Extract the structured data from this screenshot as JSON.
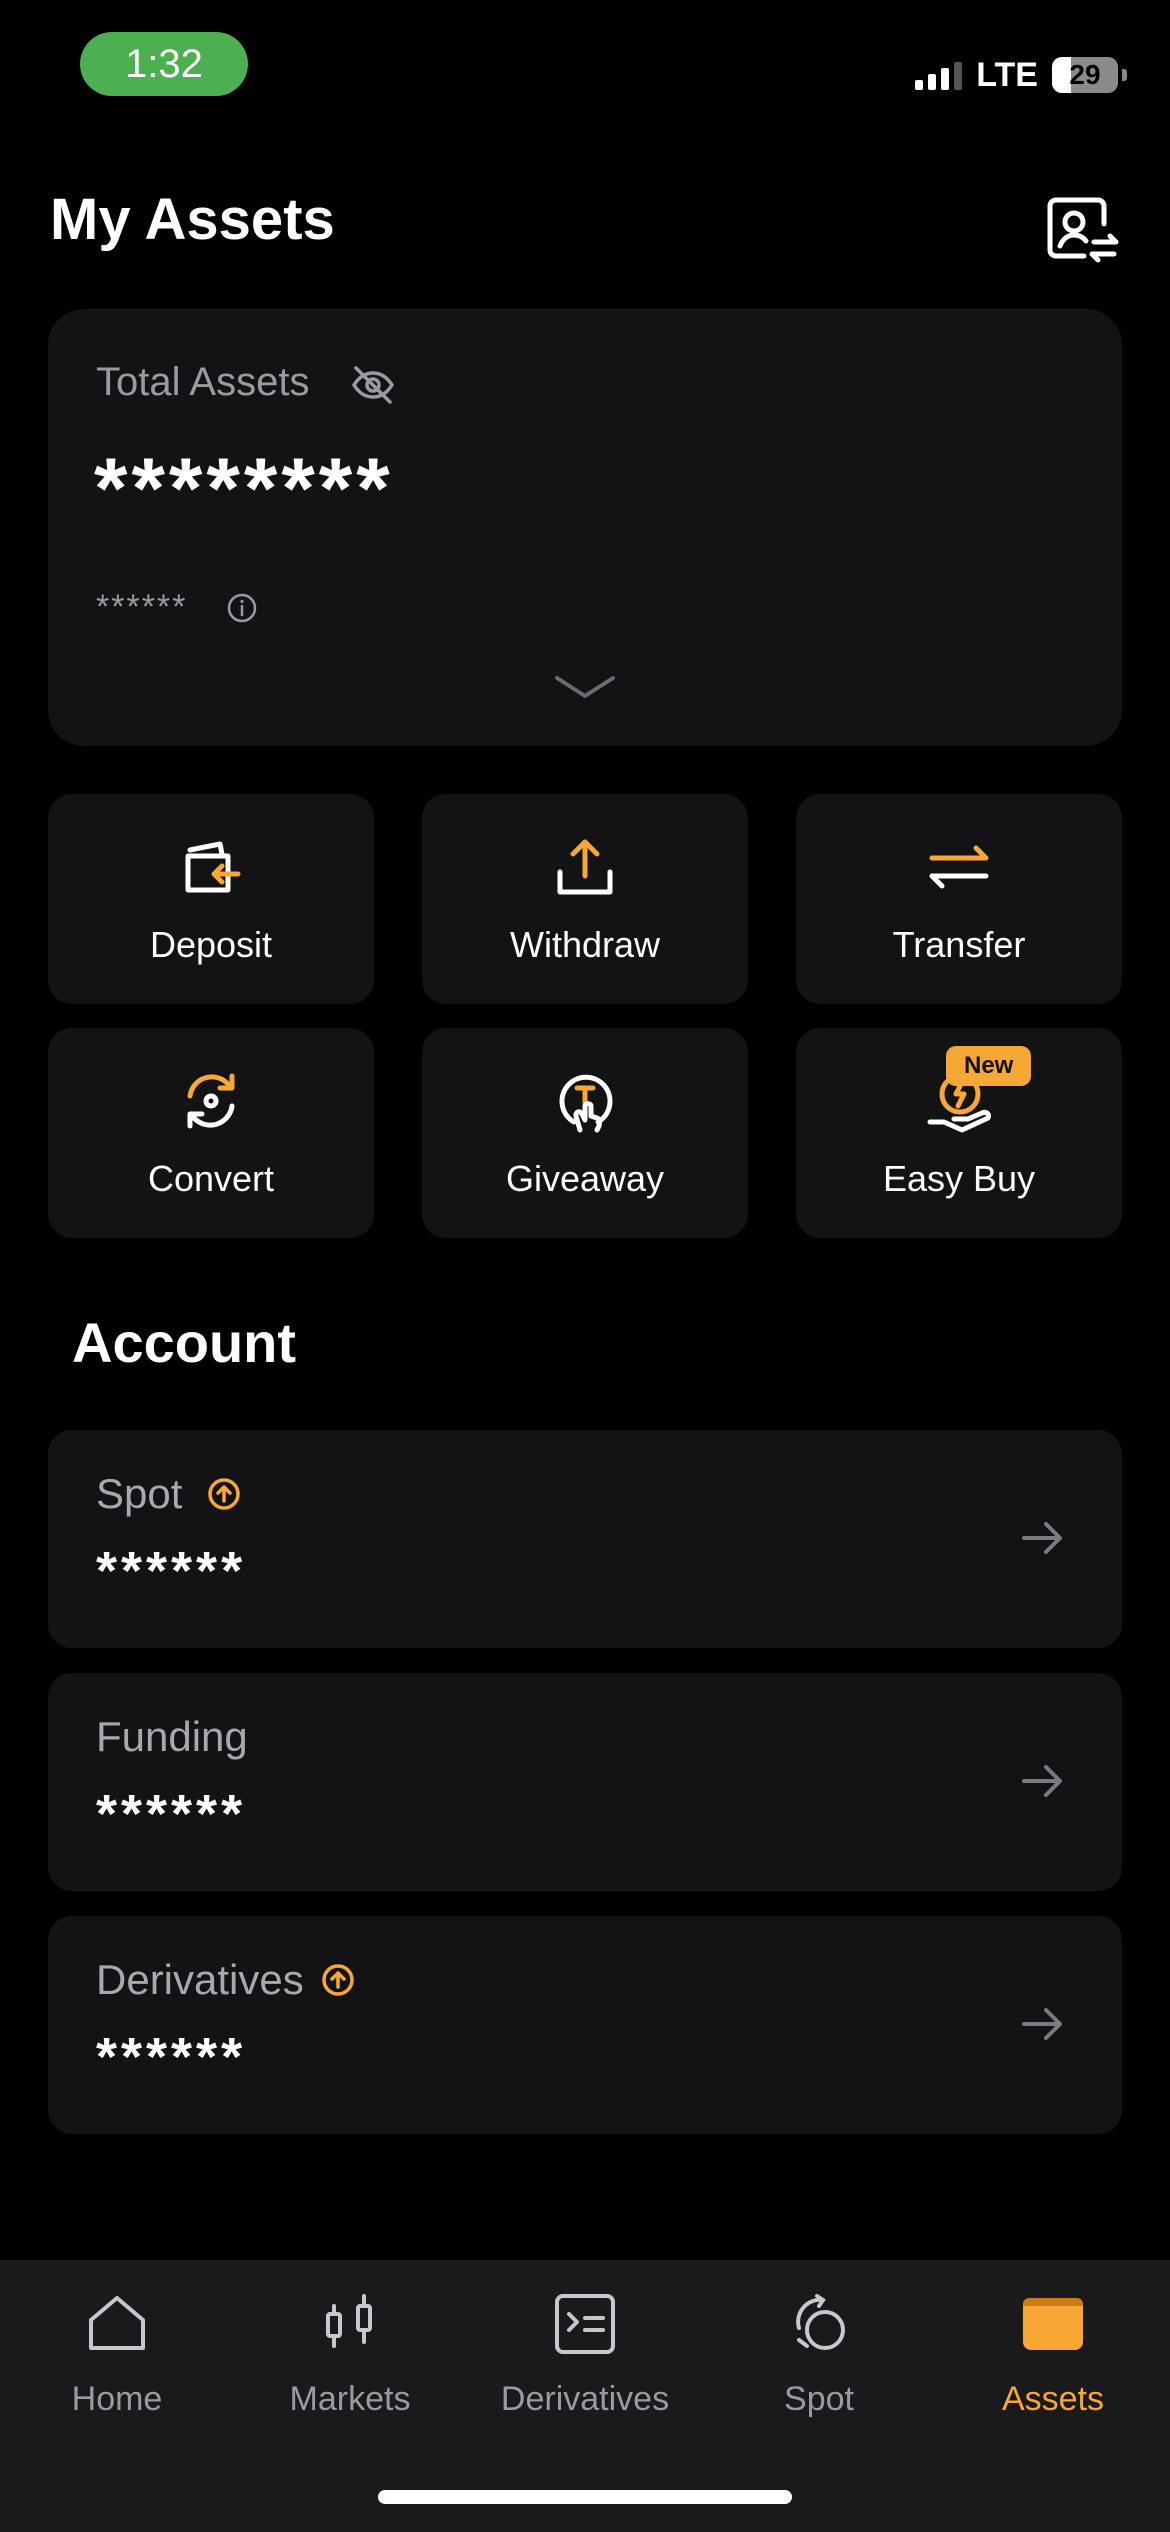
{
  "status_bar": {
    "time": "1:32",
    "network": "LTE",
    "battery": "29",
    "battery_level": 0.29,
    "signal_bars": 3
  },
  "header": {
    "title": "My Assets",
    "profile_icon": "user-switch-icon"
  },
  "total": {
    "label": "Total Assets",
    "value": "********",
    "sub_value": "******",
    "eye_icon": "eye-hidden-icon",
    "info_icon": "info-icon",
    "expand_icon": "chevron-down-icon"
  },
  "actions": [
    {
      "label": "Deposit",
      "icon": "deposit-icon"
    },
    {
      "label": "Withdraw",
      "icon": "withdraw-icon"
    },
    {
      "label": "Transfer",
      "icon": "transfer-icon"
    },
    {
      "label": "Convert",
      "icon": "convert-icon"
    },
    {
      "label": "Giveaway",
      "icon": "giveaway-icon"
    },
    {
      "label": "Easy Buy",
      "icon": "easy-buy-icon",
      "badge": "New"
    }
  ],
  "account": {
    "title": "Account",
    "items": [
      {
        "name": "Spot",
        "value": "******"
      },
      {
        "name": "Funding",
        "value": "******"
      },
      {
        "name": "Derivatives",
        "value": "******"
      }
    ]
  },
  "tabs": [
    {
      "label": "Home",
      "icon": "home-icon"
    },
    {
      "label": "Markets",
      "icon": "candlestick-icon"
    },
    {
      "label": "Derivatives",
      "icon": "derivatives-icon"
    },
    {
      "label": "Spot",
      "icon": "spot-icon"
    },
    {
      "label": "Assets",
      "icon": "wallet-icon",
      "active": true
    }
  ],
  "colors": {
    "accent": "#f7a734",
    "card": "#131316",
    "tabbar": "#1a1a1d",
    "time_pill": "#4caf50"
  }
}
